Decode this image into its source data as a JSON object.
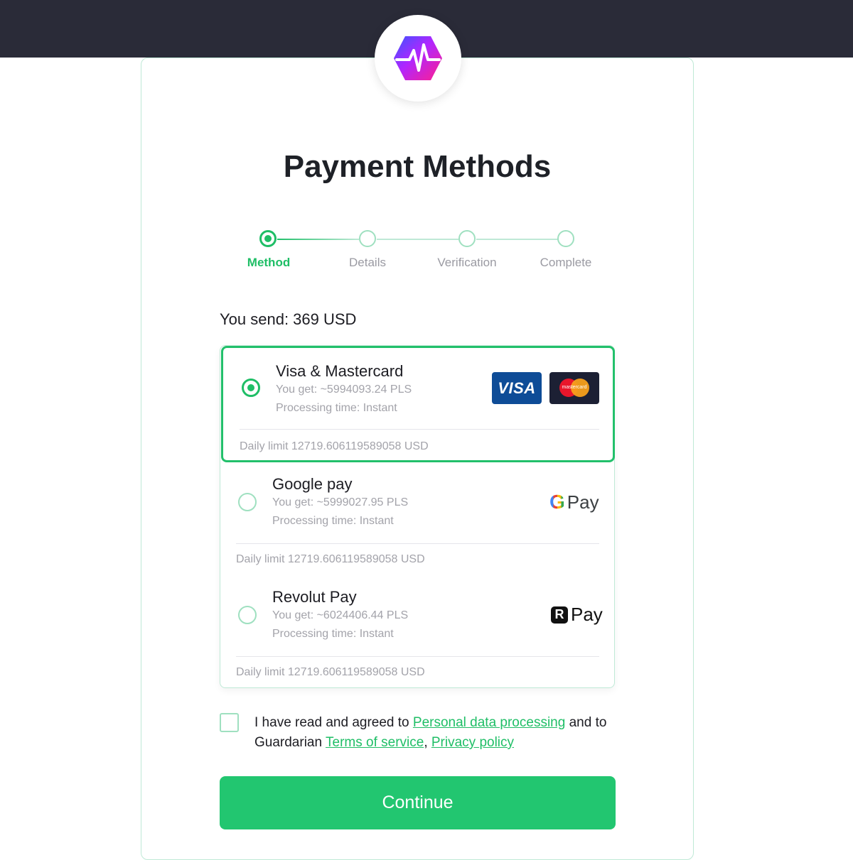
{
  "header": {
    "background": "#2a2b38",
    "logo_icon": "pulse-hexagon-logo"
  },
  "page": {
    "title": "Payment Methods",
    "accent": "#22c06b"
  },
  "stepper": {
    "steps": [
      {
        "label": "Method",
        "state": "active"
      },
      {
        "label": "Details",
        "state": "pending"
      },
      {
        "label": "Verification",
        "state": "pending"
      },
      {
        "label": "Complete",
        "state": "pending"
      }
    ]
  },
  "send": {
    "text": "You send: 369 USD"
  },
  "methods": [
    {
      "name": "Visa & Mastercard",
      "you_get": "You get: ~5994093.24 PLS",
      "processing": "Processing time: Instant",
      "limit": "Daily limit 12719.606119589058 USD",
      "selected": true,
      "logos": {
        "visa": "VISA",
        "mastercard": "mastercard"
      }
    },
    {
      "name": "Google pay",
      "you_get": "You get: ~5999027.95 PLS",
      "processing": "Processing time: Instant",
      "limit": "Daily limit 12719.606119589058 USD",
      "selected": false,
      "logo": {
        "glyph": "G",
        "text": "Pay"
      }
    },
    {
      "name": "Revolut Pay",
      "you_get": "You get: ~6024406.44 PLS",
      "processing": "Processing time: Instant",
      "limit": "Daily limit 12719.606119589058 USD",
      "selected": false,
      "logo": {
        "glyph": "R",
        "text": "Pay"
      }
    }
  ],
  "agreement": {
    "checked": false,
    "text_1": "I have read and agreed to ",
    "link_personal": "Personal data processing",
    "text_2": " and to Guardarian ",
    "link_terms": "Terms of service",
    "text_3": ", ",
    "link_privacy": "Privacy policy"
  },
  "continue_label": "Continue"
}
